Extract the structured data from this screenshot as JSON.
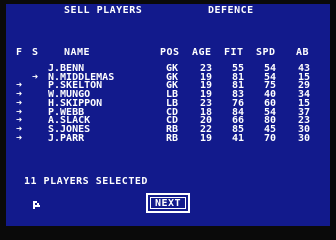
{
  "title": {
    "left": "SELL PLAYERS",
    "right": "DEFENCE"
  },
  "columns": [
    "F",
    "S",
    "NAME",
    "POS",
    "AGE",
    "FIT",
    "SPD",
    "AB"
  ],
  "players": [
    {
      "name": "J.BENN",
      "pos": "GK",
      "age": "23",
      "fit": "55",
      "spd": "54",
      "ab": "43",
      "selected": false
    },
    {
      "name": "N.MIDDLEMAS",
      "pos": "GK",
      "age": "19",
      "fit": "81",
      "spd": "54",
      "ab": "15",
      "selected": true
    },
    {
      "name": "P.SKELTON",
      "pos": "GK",
      "age": "19",
      "fit": "81",
      "spd": "75",
      "ab": "29",
      "selected": true
    },
    {
      "name": "W.MUNGO",
      "pos": "LB",
      "age": "19",
      "fit": "83",
      "spd": "40",
      "ab": "34",
      "selected": true
    },
    {
      "name": "H.SKIPPON",
      "pos": "LB",
      "age": "23",
      "fit": "76",
      "spd": "60",
      "ab": "15",
      "selected": true
    },
    {
      "name": "P.WEBB",
      "pos": "CD",
      "age": "18",
      "fit": "84",
      "spd": "54",
      "ab": "37",
      "selected": true
    },
    {
      "name": "A.SLACK",
      "pos": "CD",
      "age": "20",
      "fit": "66",
      "spd": "80",
      "ab": "23",
      "selected": true
    },
    {
      "name": "S.JONES",
      "pos": "RB",
      "age": "22",
      "fit": "85",
      "spd": "45",
      "ab": "30",
      "selected": true
    },
    {
      "name": "J.PARR",
      "pos": "RB",
      "age": "19",
      "fit": "41",
      "spd": "70",
      "ab": "30",
      "selected": true
    }
  ],
  "selected_count_label": "11 PLAYERS SELECTED",
  "next_label": "NEXT",
  "colors": {
    "background": "#121a8c",
    "text": "#ffffff"
  }
}
